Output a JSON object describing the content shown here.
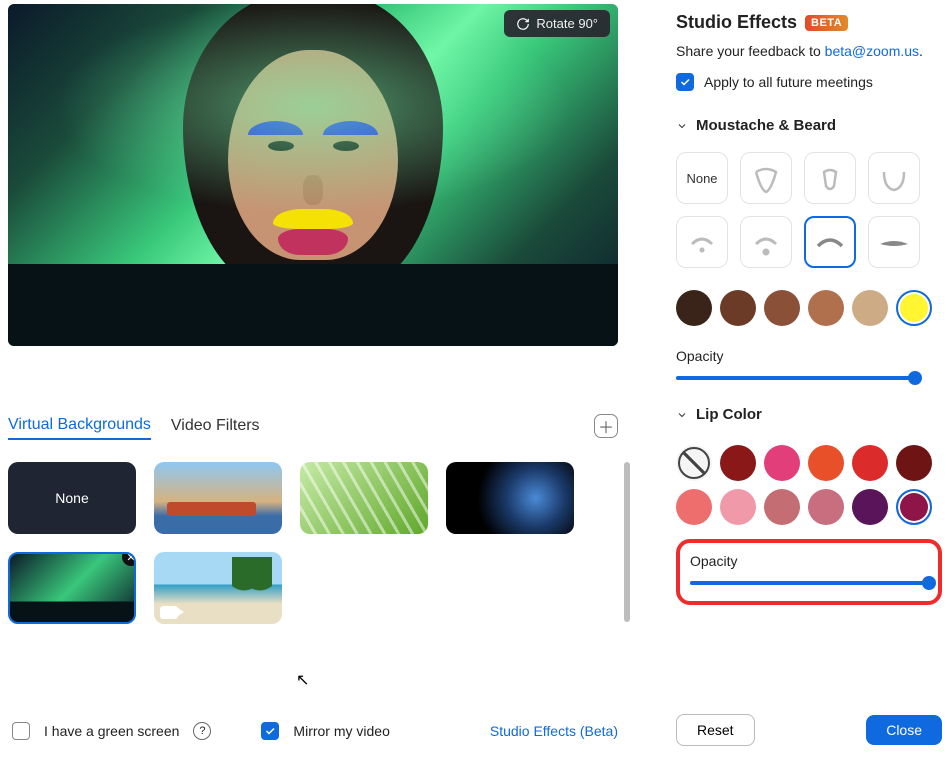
{
  "preview": {
    "rotate_label": "Rotate 90°"
  },
  "tabs": {
    "virtual_bg": "Virtual Backgrounds",
    "video_filters": "Video Filters"
  },
  "backgrounds": {
    "none_label": "None"
  },
  "bottom": {
    "green_screen_label": "I have a green screen",
    "mirror_label": "Mirror my video",
    "studio_link": "Studio Effects (Beta)"
  },
  "studio": {
    "title": "Studio Effects",
    "beta": "BETA",
    "feedback_prefix": "Share your feedback to  ",
    "feedback_email": "beta@zoom.us",
    "apply_label": "Apply to all future meetings",
    "moustache_title": "Moustache & Beard",
    "none_label": "None",
    "opacity_label": "Opacity",
    "lip_title": "Lip Color",
    "beard_colors": [
      "#3a241a",
      "#6b3b28",
      "#8a5038",
      "#b0704d",
      "#ccab85",
      "#fff531"
    ],
    "beard_selected_color_index": 5,
    "beard_selected_shape_index": 6,
    "lip_colors_row1": [
      "none",
      "#8a1818",
      "#e23e7a",
      "#e8502a",
      "#db2b2b",
      "#6f1414"
    ],
    "lip_colors_row2": [
      "#ee6e6e",
      "#f09aa9",
      "#c46e74",
      "#c86e7e",
      "#5a145a",
      "#8f1548"
    ],
    "lip_selected_index": 11,
    "opacity_moustache": 100,
    "opacity_lip": 100
  },
  "footer": {
    "reset": "Reset",
    "close": "Close"
  }
}
